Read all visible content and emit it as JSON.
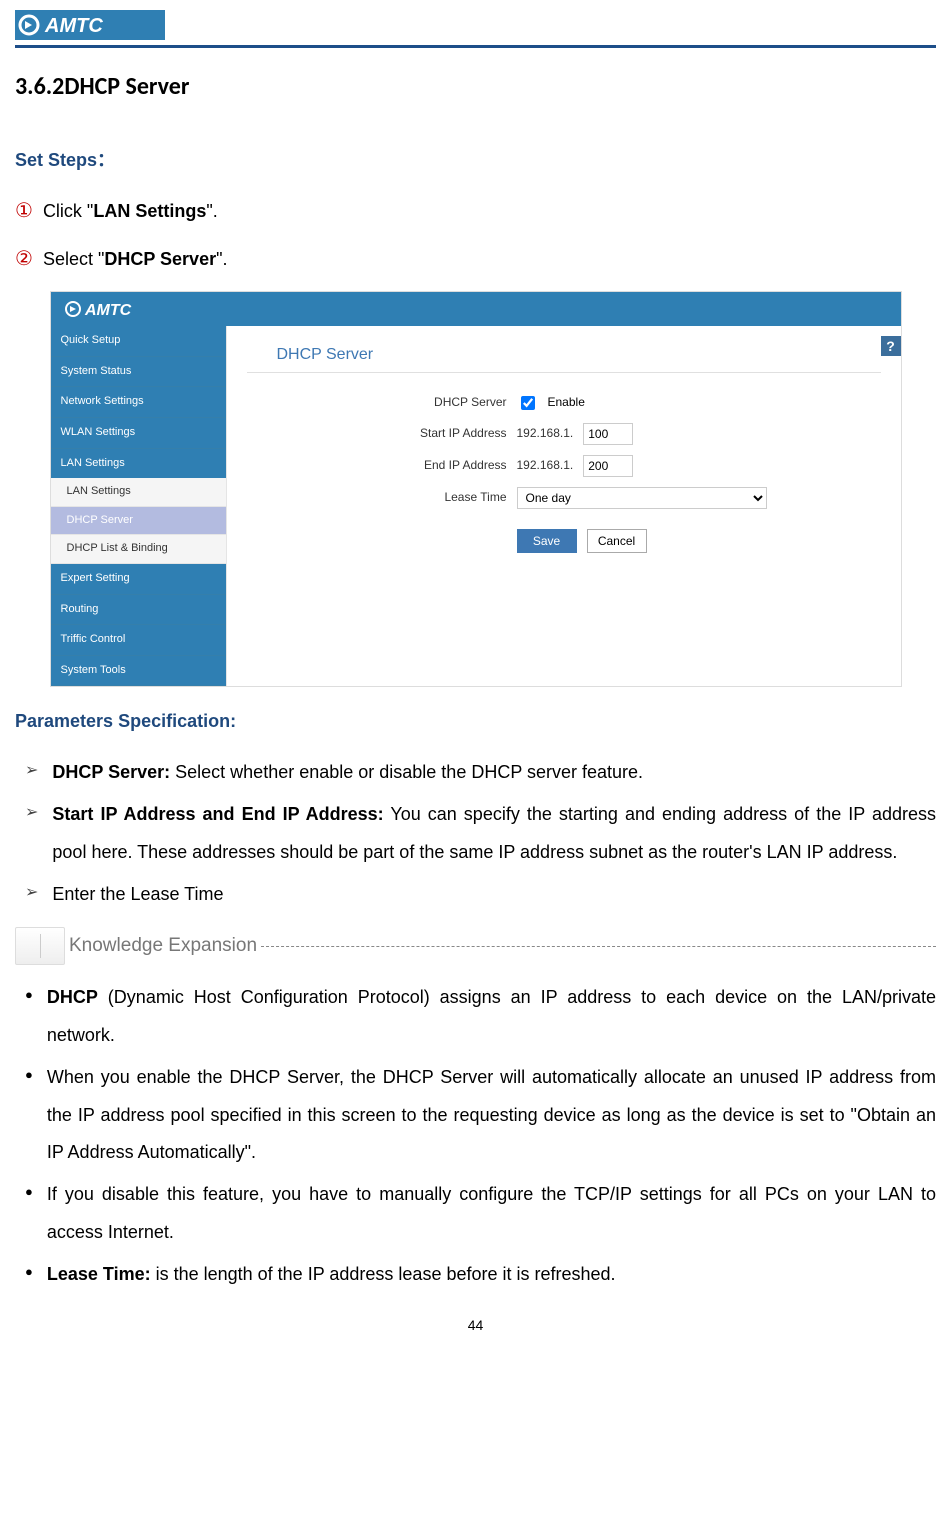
{
  "logo_text": "AMTC",
  "section_title": "3.6.2DHCP Server",
  "set_steps_label": "Set Steps：",
  "steps": [
    {
      "num": "①",
      "pre": "Click \"",
      "bold": "LAN Settings",
      "post": "\"."
    },
    {
      "num": "②",
      "pre": "Select \"",
      "bold": "DHCP Server",
      "post": "\"."
    }
  ],
  "screenshot": {
    "sidebar_main": [
      "Quick Setup",
      "System Status",
      "Network Settings",
      "WLAN Settings",
      "LAN Settings"
    ],
    "sidebar_sub": [
      "LAN Settings",
      "DHCP Server",
      "DHCP List & Binding"
    ],
    "sidebar_sub_selected": "DHCP Server",
    "sidebar_tail": [
      "Expert Setting",
      "Routing",
      "Triffic Control",
      "System Tools"
    ],
    "page_title": "DHCP Server",
    "rows": {
      "dhcp_label": "DHCP Server",
      "enable_label": "Enable",
      "start_label": "Start IP Address",
      "end_label": "End IP Address",
      "ip_prefix": "192.168.1.",
      "start_val": "100",
      "end_val": "200",
      "lease_label": "Lease Time",
      "lease_val": "One day"
    },
    "save_label": "Save",
    "cancel_label": "Cancel",
    "help_badge": "?"
  },
  "param_spec_label": "Parameters Specification:",
  "params": [
    {
      "bold": "DHCP Server:",
      "text": " Select whether enable or disable the DHCP server feature."
    },
    {
      "bold": "Start IP Address and End IP Address:",
      "text": " You can specify the starting and ending address of the IP address pool here. These addresses should be part of the same IP address subnet as the router's LAN IP address."
    },
    {
      "bold": "",
      "text": "Enter the Lease Time"
    }
  ],
  "kx_label": "Knowledge Expansion",
  "kx_items": [
    {
      "bold": "DHCP",
      "text": " (Dynamic Host Configuration Protocol) assigns an IP address to each device on the LAN/private network."
    },
    {
      "bold": "",
      "text": "When you enable the DHCP Server, the DHCP Server will automatically allocate an unused IP address from the IP address pool specified in this screen to the requesting device as long as the device is set to \"Obtain an IP Address Automatically\"."
    },
    {
      "bold": "",
      "text": "If you disable this feature, you have to manually configure the TCP/IP settings for all PCs on your LAN to access Internet."
    },
    {
      "bold": "Lease Time:",
      "text": " is the length of the IP address lease before it is refreshed."
    }
  ],
  "page_number": "44"
}
